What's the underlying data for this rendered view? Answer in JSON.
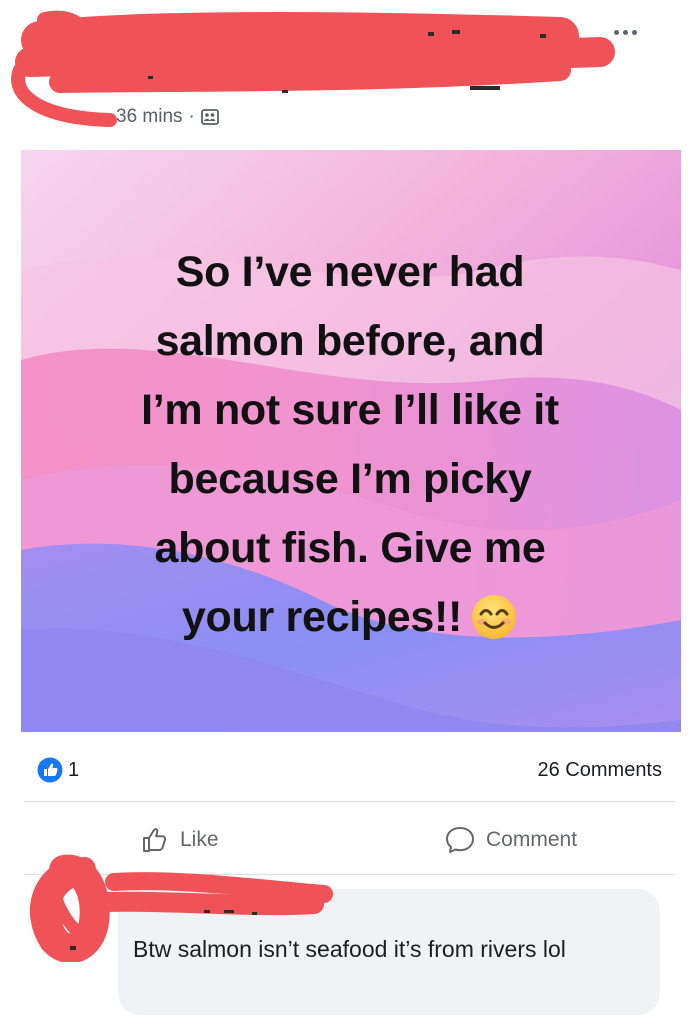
{
  "post": {
    "timestamp": "36 mins",
    "separator": "·",
    "audience_icon": "friends-album-icon",
    "text_lines": [
      "So I’ve never had",
      "salmon before, and",
      "I’m not sure I’ll like it",
      "because I’m picky",
      "about fish. Give me",
      "your recipes!!"
    ],
    "emoji": "smiling-face-icon"
  },
  "reactions": {
    "like_count": "1",
    "comments_label": "26 Comments"
  },
  "actions": {
    "like_label": "Like",
    "comment_label": "Comment"
  },
  "comment": {
    "text": "Btw salmon isn’t seafood it’s from rivers  lol"
  },
  "colors": {
    "facebook_blue": "#1877f2",
    "redaction_red": "#f0565a",
    "comment_bubble": "#f0f2f5"
  }
}
